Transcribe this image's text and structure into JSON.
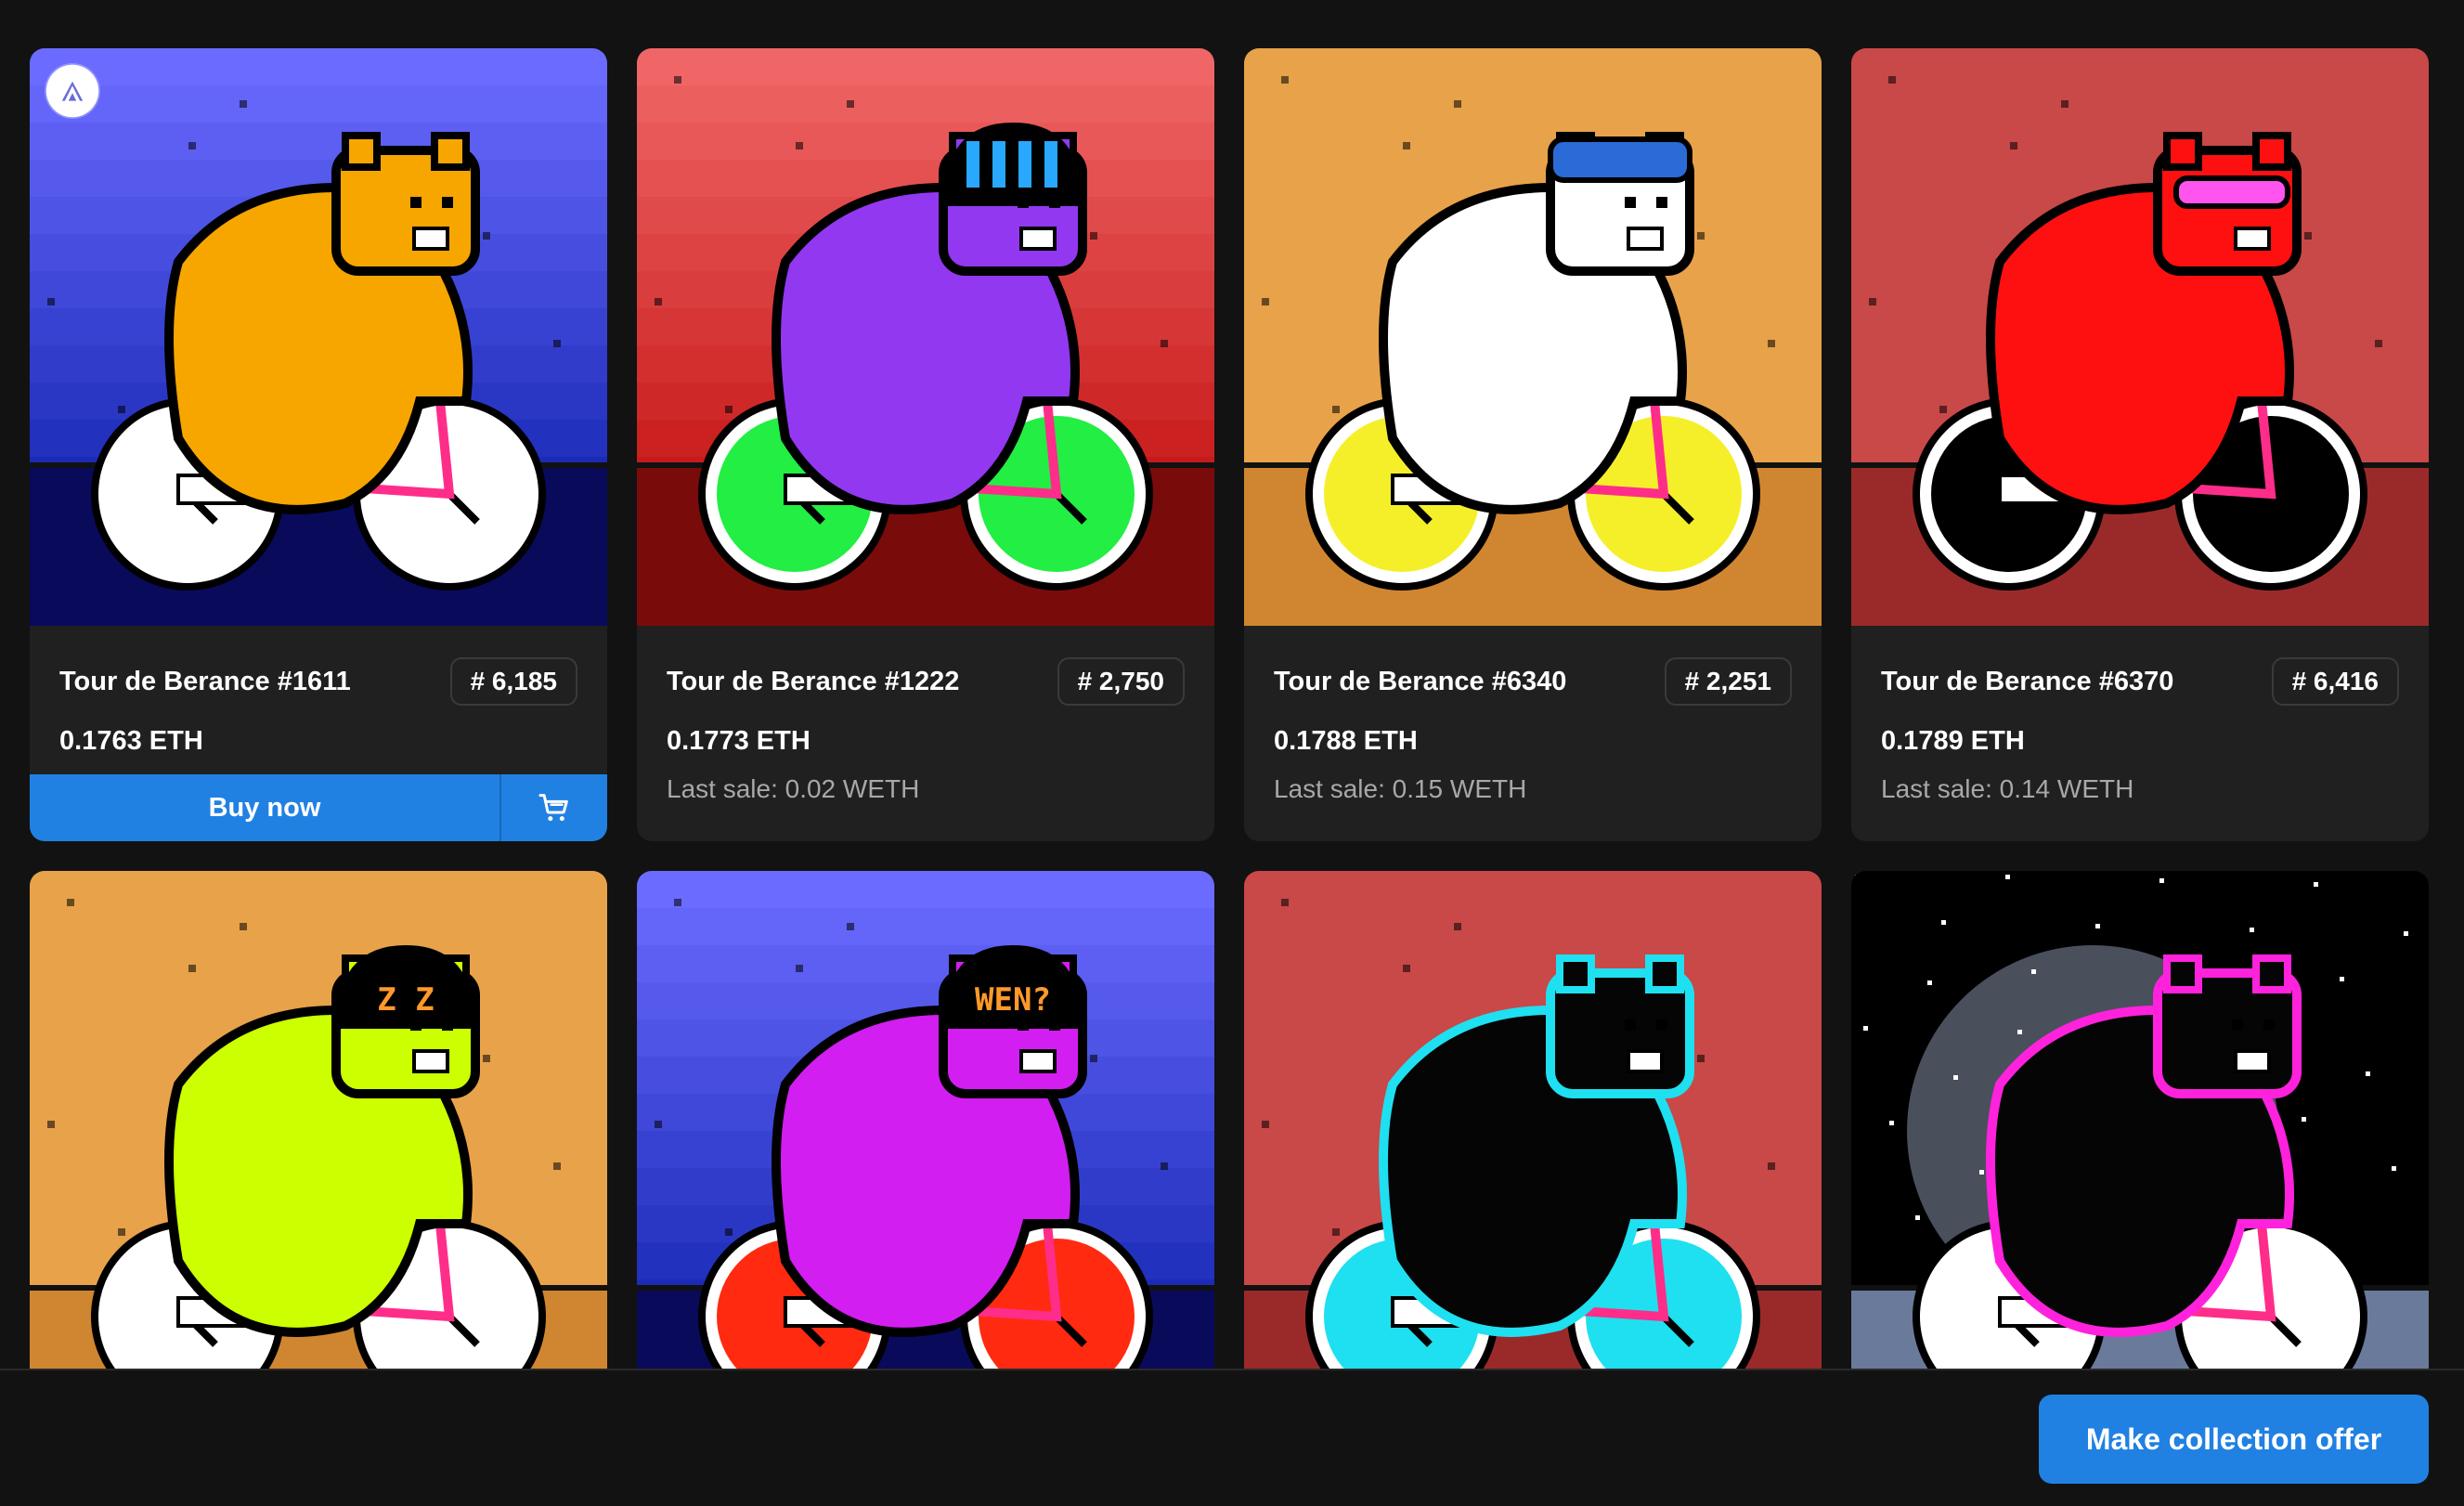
{
  "cards": [
    {
      "title": "Tour de Berance #1611",
      "rank": "# 6,185",
      "price": "0.1763 ETH",
      "last_sale": "",
      "buy_label": "Buy now",
      "bg_top": "#6b6bff",
      "bg_bottom": "#1b2bb8",
      "ground": "#0a0a5a",
      "bear": "#f7a600",
      "wheel": "#ffffff",
      "accessory": "none"
    },
    {
      "title": "Tour de Berance #1222",
      "rank": "# 2,750",
      "price": "0.1773 ETH",
      "last_sale": "Last sale: 0.02 WETH",
      "bg_top": "#f06666",
      "bg_bottom": "#c81a1a",
      "ground": "#7a0b0b",
      "bear": "#9238f0",
      "wheel": "#22ee44",
      "accessory": "helmet"
    },
    {
      "title": "Tour de Berance #6340",
      "rank": "# 2,251",
      "price": "0.1788 ETH",
      "last_sale": "Last sale: 0.15 WETH",
      "bg_top": "#e8a24a",
      "bg_bottom": "#e8a24a",
      "ground": "#d08630",
      "bear": "#ffffff",
      "wheel": "#f5ef2a",
      "accessory": "cap"
    },
    {
      "title": "Tour de Berance #6370",
      "rank": "# 6,416",
      "price": "0.1789 ETH",
      "last_sale": "Last sale: 0.14 WETH",
      "bg_top": "#c94848",
      "bg_bottom": "#c94848",
      "ground": "#9a2a2a",
      "bear": "#ff1010",
      "wheel": "#000000",
      "accessory": "goggles"
    },
    {
      "bg_top": "#e8a24a",
      "bg_bottom": "#e8a24a",
      "ground": "#d08630",
      "bear": "#ccff00",
      "wheel": "#ffffff",
      "accessory": "helmet",
      "helmet_text": "Z Z"
    },
    {
      "bg_top": "#6b6bff",
      "bg_bottom": "#1b2bb8",
      "ground": "#0a0a5a",
      "bear": "#d21ef0",
      "wheel": "#ff2a10",
      "accessory": "helmet",
      "helmet_text": "WEN?"
    },
    {
      "bg_top": "#c94848",
      "bg_bottom": "#c94848",
      "ground": "#9a2a2a",
      "bear": "#050505",
      "outline": "#1ee0f0",
      "wheel": "#1ee0f0",
      "accessory": "none"
    },
    {
      "bg_top": "#000000",
      "bg_bottom": "#000000",
      "ground": "#6a7a9a",
      "bear": "#050505",
      "outline": "#ff22dd",
      "wheel": "#ffffff",
      "accessory": "moon"
    }
  ],
  "footer": {
    "offer_label": "Make collection offer"
  },
  "icons": {
    "chain": "chain-logo-icon",
    "cart": "cart-icon"
  },
  "colors": {
    "accent": "#2081e2",
    "card_bg": "#202020",
    "page_bg": "#121212"
  }
}
